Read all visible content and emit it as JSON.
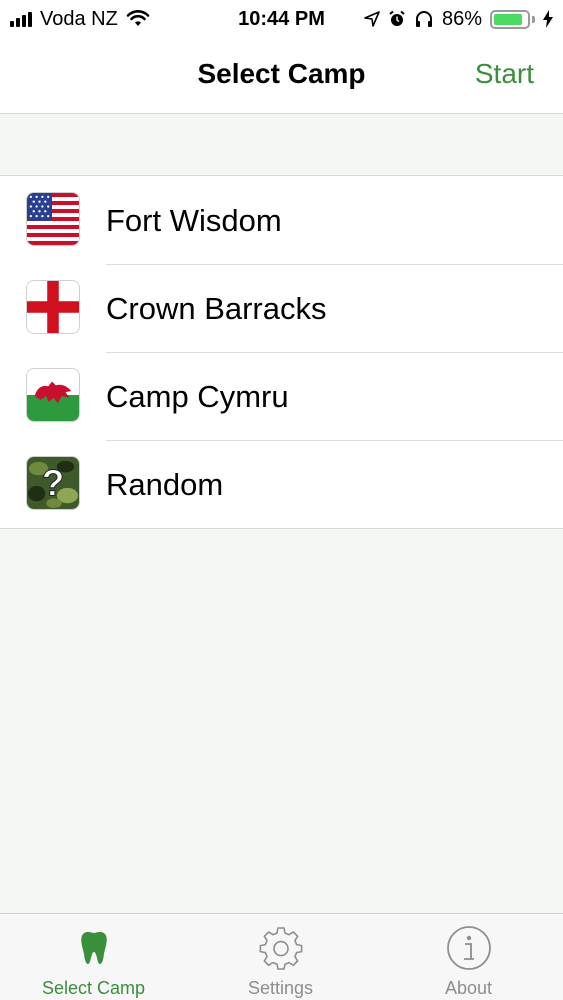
{
  "status_bar": {
    "carrier": "Voda NZ",
    "time": "10:44 PM",
    "battery_percent": "86%",
    "battery_level": 0.86,
    "icons": [
      "signal-icon",
      "wifi-icon",
      "location-icon",
      "alarm-icon",
      "headphones-icon",
      "battery-icon",
      "charging-icon"
    ]
  },
  "nav": {
    "title": "Select Camp",
    "start_label": "Start",
    "accent_color": "#3a8f3a"
  },
  "camps": [
    {
      "label": "Fort Wisdom",
      "icon": "usa-flag-icon"
    },
    {
      "label": "Crown Barracks",
      "icon": "england-flag-icon"
    },
    {
      "label": "Camp Cymru",
      "icon": "wales-flag-icon"
    },
    {
      "label": "Random",
      "icon": "random-camo-question-icon"
    }
  ],
  "tabs": [
    {
      "label": "Select Camp",
      "icon": "tooth-icon",
      "active": true
    },
    {
      "label": "Settings",
      "icon": "gear-icon",
      "active": false
    },
    {
      "label": "About",
      "icon": "info-icon",
      "active": false
    }
  ]
}
